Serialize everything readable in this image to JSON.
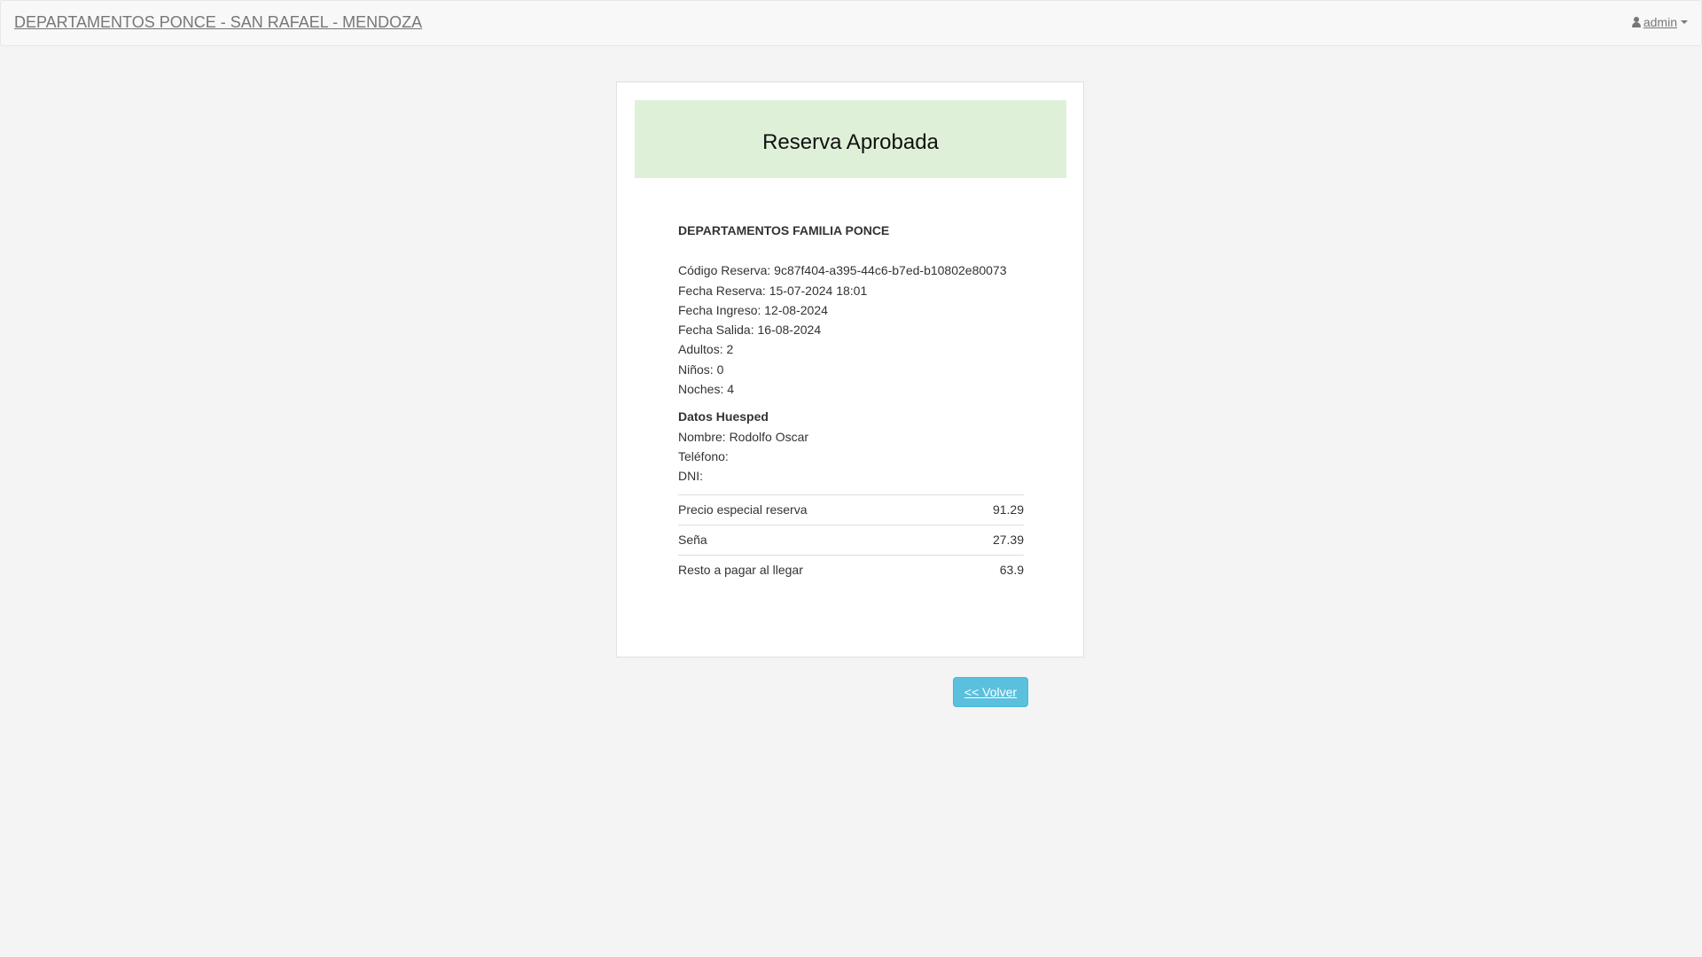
{
  "navbar": {
    "brand": "DEPARTAMENTOS PONCE - SAN RAFAEL - MENDOZA",
    "user": {
      "icon": "user-icon",
      "label": "admin"
    }
  },
  "card": {
    "banner_title": "Reserva Aprobada",
    "banner_color": "#dff0d8",
    "company": "DEPARTAMENTOS FAMILIA PONCE",
    "details": {
      "codigo": "Código Reserva: 9c87f404-a395-44c6-b7ed-b10802e80073",
      "fecha_reserva": "Fecha Reserva: 15-07-2024 18:01",
      "fecha_ingreso": "Fecha Ingreso: 12-08-2024",
      "fecha_salida": "Fecha Salida: 16-08-2024",
      "adultos": "Adultos: 2",
      "ninos": "Niños: 0",
      "noches": "Noches: 4"
    },
    "guest": {
      "title": "Datos Huesped",
      "nombre": "Nombre: Rodolfo Oscar",
      "telefono": "Teléfono:",
      "dni": "DNI:"
    },
    "prices": [
      {
        "label": "Precio especial reserva",
        "value": "91.29"
      },
      {
        "label": "Seña",
        "value": "27.39"
      },
      {
        "label": "Resto a pagar al llegar",
        "value": "63.9"
      }
    ]
  },
  "back_button": {
    "label": "<< Volver",
    "color": "#5bc0de"
  }
}
